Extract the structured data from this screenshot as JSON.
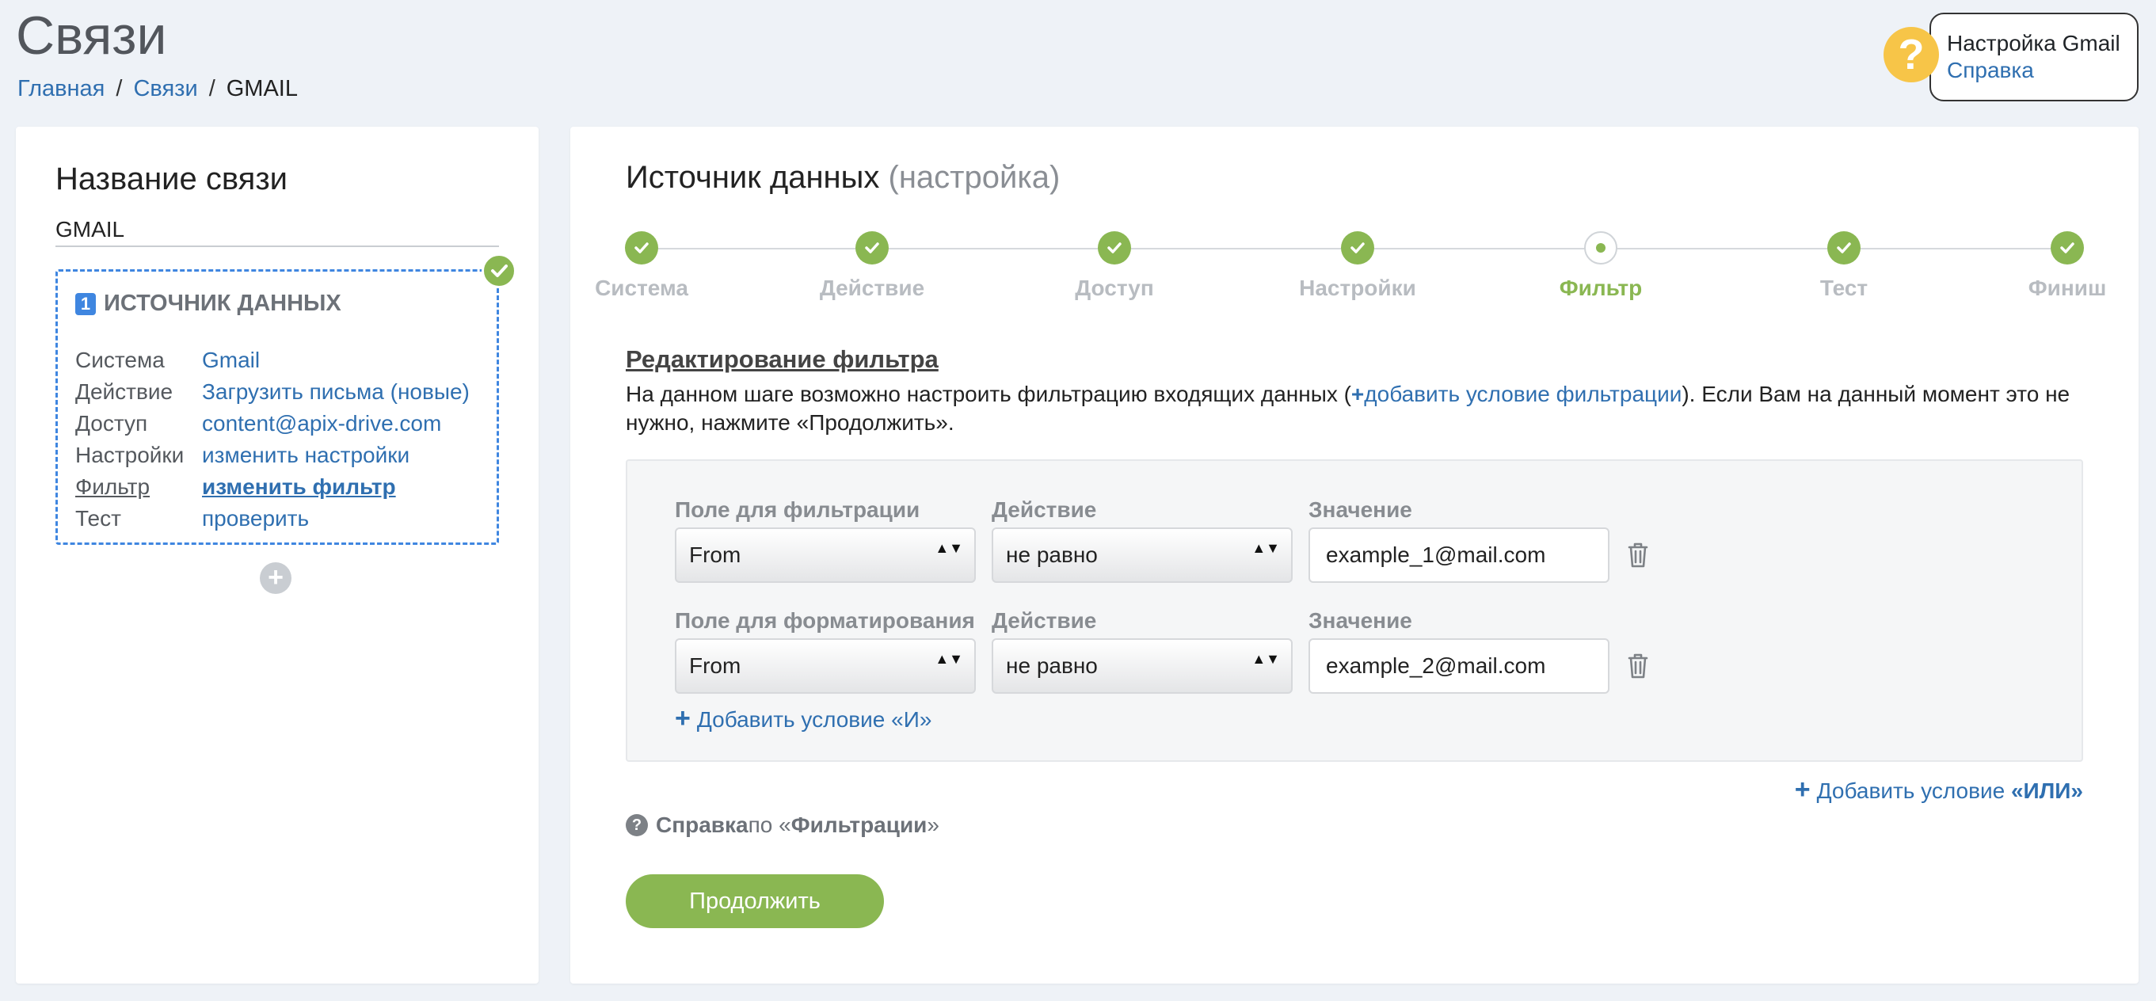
{
  "page": {
    "title": "Связи",
    "breadcrumb": [
      "Главная",
      "Связи",
      "GMAIL"
    ],
    "sep": "/"
  },
  "help": {
    "title": "Настройка Gmail",
    "link": "Справка",
    "icon": "?"
  },
  "connection": {
    "title": "Название связи",
    "name": "GMAIL",
    "source": {
      "badge": "1",
      "heading": "ИСТОЧНИК ДАННЫХ",
      "rows": [
        {
          "key": "Система",
          "value": "Gmail"
        },
        {
          "key": "Действие",
          "value": "Загрузить письма (новые)"
        },
        {
          "key": "Доступ",
          "value": "content@apix-drive.com"
        },
        {
          "key": "Настройки",
          "value": "изменить настройки"
        },
        {
          "key": "Фильтр",
          "value": "изменить фильтр"
        },
        {
          "key": "Тест",
          "value": "проверить"
        }
      ]
    },
    "add_symbol": "+"
  },
  "data_source": {
    "title": "Источник данных",
    "subtitle": "(настройка)",
    "steps": [
      "Система",
      "Действие",
      "Доступ",
      "Настройки",
      "Фильтр",
      "Тест",
      "Финиш"
    ],
    "current_step": "Фильтр"
  },
  "filter": {
    "heading": "Редактирование фильтра",
    "desc_before": "На данном шаге возможно настроить фильтрацию входящих данных (",
    "desc_link": "добавить условие фильтрации",
    "desc_after": "). Если Вам на данный момент это не нужно, нажмите «Продолжить».",
    "rows": [
      {
        "field_label": "Поле для фильтрации",
        "action_label": "Действие",
        "value_label": "Значение",
        "field": "From",
        "action": "не равно",
        "value": "example_1@mail.com"
      },
      {
        "field_label": "Поле для форматирования",
        "action_label": "Действие",
        "value_label": "Значение",
        "field": "From",
        "action": "не равно",
        "value": "example_2@mail.com"
      }
    ],
    "add_and": "Добавить условие «И»",
    "add_or_prefix": "Добавить условие ",
    "add_or_strong": "«ИЛИ»",
    "help_strong": "Справка",
    "help_mid": " по «",
    "help_topic": "Фильтрации",
    "help_end": "»",
    "plus": "+",
    "select_arrows": "▲▼"
  },
  "continue_label": "Продолжить",
  "colors": {
    "accent_green": "#8ab752",
    "link_blue": "#2f6fb0",
    "dashed_blue": "#3f86e0",
    "help_yellow": "#f7c548"
  }
}
